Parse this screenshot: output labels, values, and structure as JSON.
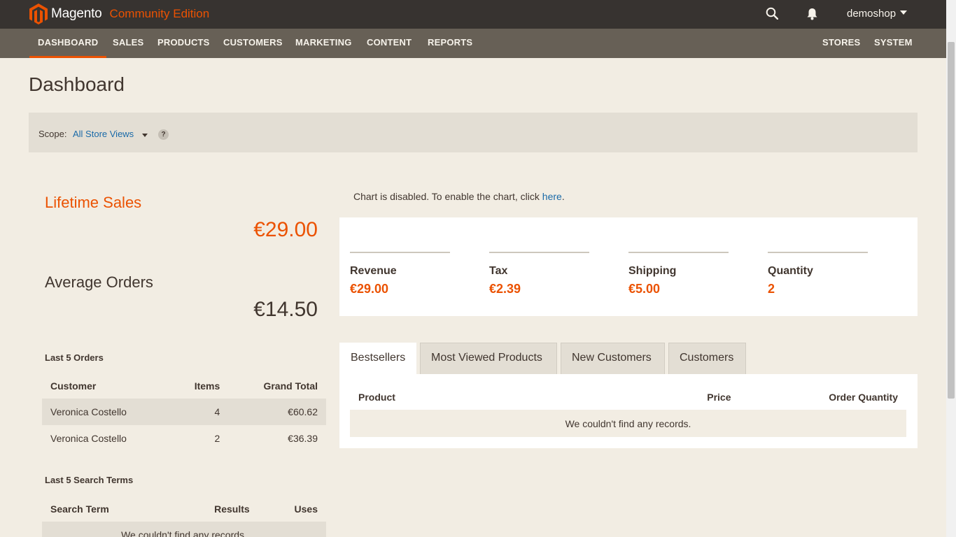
{
  "header": {
    "brand": "Magento",
    "edition": "Community Edition",
    "user": "demoshop",
    "icons": {
      "logo": "magento-logo-icon",
      "search": "search-icon",
      "notifications": "bell-icon"
    },
    "colors": {
      "accent": "#eb5202",
      "topbar": "#373330",
      "nav": "#676056"
    }
  },
  "nav": {
    "left": [
      "DASHBOARD",
      "SALES",
      "PRODUCTS",
      "CUSTOMERS",
      "MARKETING",
      "CONTENT",
      "REPORTS"
    ],
    "right": [
      "STORES",
      "SYSTEM"
    ],
    "active": "DASHBOARD"
  },
  "page": {
    "title": "Dashboard"
  },
  "scope": {
    "label": "Scope:",
    "value": "All Store Views",
    "help": "?"
  },
  "stats": {
    "lifetime_sales_label": "Lifetime Sales",
    "lifetime_sales_value": "€29.00",
    "average_orders_label": "Average Orders",
    "average_orders_value": "€14.50"
  },
  "last_orders": {
    "title": "Last 5 Orders",
    "headers": [
      "Customer",
      "Items",
      "Grand Total"
    ],
    "rows": [
      {
        "customer": "Veronica Costello",
        "items": "4",
        "total": "€60.62"
      },
      {
        "customer": "Veronica Costello",
        "items": "2",
        "total": "€36.39"
      }
    ]
  },
  "last_search_terms": {
    "title": "Last 5 Search Terms",
    "headers": [
      "Search Term",
      "Results",
      "Uses"
    ],
    "empty": "We couldn't find any records."
  },
  "chart": {
    "message": "Chart is disabled. To enable the chart, click ",
    "link": "here",
    "suffix": "."
  },
  "totals": [
    {
      "label": "Revenue",
      "value": "€29.00"
    },
    {
      "label": "Tax",
      "value": "€2.39"
    },
    {
      "label": "Shipping",
      "value": "€5.00"
    },
    {
      "label": "Quantity",
      "value": "2"
    }
  ],
  "tabs": {
    "items": [
      "Bestsellers",
      "Most Viewed Products",
      "New Customers",
      "Customers"
    ],
    "active": "Bestsellers",
    "headers": [
      "Product",
      "Price",
      "Order Quantity"
    ],
    "empty": "We couldn't find any records."
  }
}
